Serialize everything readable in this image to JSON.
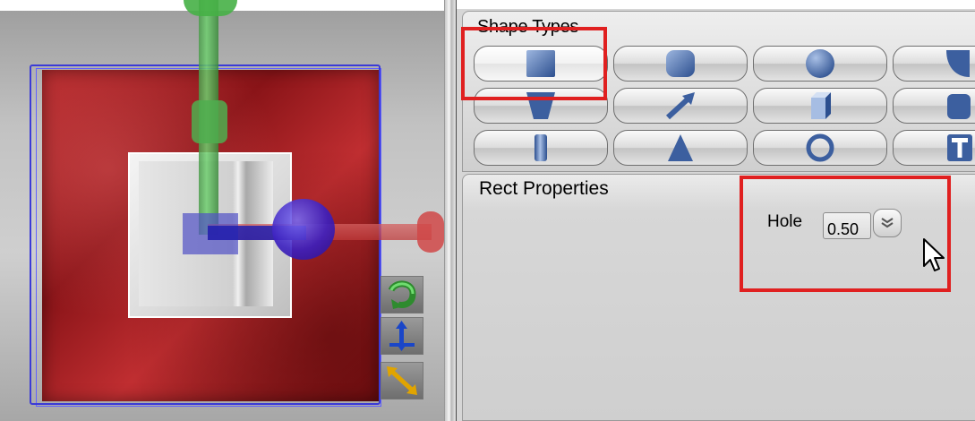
{
  "shape_types": {
    "title": "Shape Types",
    "buttons": [
      {
        "name": "rect",
        "selected": true
      },
      {
        "name": "rounded-rect",
        "selected": false
      },
      {
        "name": "circle",
        "selected": false
      },
      {
        "name": "quarter-circle",
        "selected": false
      },
      {
        "name": "trapezoid",
        "selected": false
      },
      {
        "name": "arrow",
        "selected": false
      },
      {
        "name": "cube",
        "selected": false
      },
      {
        "name": "rounded-box",
        "selected": false
      },
      {
        "name": "cylinder",
        "selected": false
      },
      {
        "name": "cone",
        "selected": false
      },
      {
        "name": "ring",
        "selected": false
      },
      {
        "name": "text",
        "selected": false
      }
    ]
  },
  "rect_properties": {
    "title": "Rect Properties",
    "hole_label": "Hole",
    "hole_value": "0.50"
  },
  "viewport": {
    "tools": [
      "rotate-tool",
      "move-tool",
      "scale-tool"
    ]
  },
  "colors": {
    "highlight": "#e02020",
    "shape_fill": "#b3272a",
    "selection_outline": "#3b3bd6"
  }
}
